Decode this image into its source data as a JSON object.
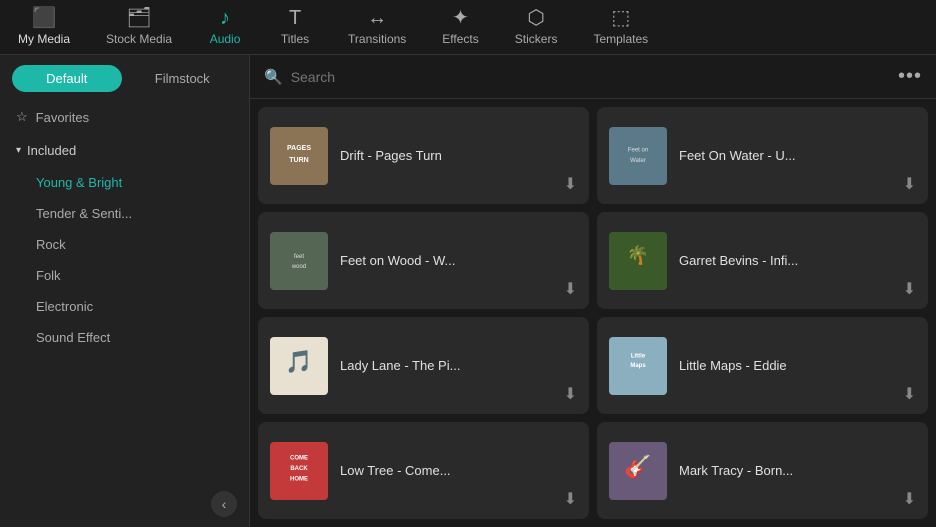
{
  "nav": {
    "items": [
      {
        "id": "my-media",
        "label": "My Media",
        "icon": "🖥",
        "active": true
      },
      {
        "id": "stock-media",
        "label": "Stock Media",
        "icon": "🗂",
        "active": false
      },
      {
        "id": "audio",
        "label": "Audio",
        "icon": "♪",
        "active": true
      },
      {
        "id": "titles",
        "label": "Titles",
        "icon": "T",
        "active": false
      },
      {
        "id": "transitions",
        "label": "Transitions",
        "icon": "↔",
        "active": false
      },
      {
        "id": "effects",
        "label": "Effects",
        "icon": "✦",
        "active": false
      },
      {
        "id": "stickers",
        "label": "Stickers",
        "icon": "⬡",
        "active": false
      },
      {
        "id": "templates",
        "label": "Templates",
        "icon": "⬚",
        "active": false
      }
    ]
  },
  "sidebar": {
    "tabs": [
      {
        "id": "default",
        "label": "Default",
        "active": true
      },
      {
        "id": "filmstock",
        "label": "Filmstock",
        "active": false
      }
    ],
    "favorites_label": "Favorites",
    "included_label": "Included",
    "sub_items": [
      {
        "id": "young-bright",
        "label": "Young & Bright",
        "active": true
      },
      {
        "id": "tender-senti",
        "label": "Tender & Senti...",
        "active": false
      },
      {
        "id": "rock",
        "label": "Rock",
        "active": false
      },
      {
        "id": "folk",
        "label": "Folk",
        "active": false
      },
      {
        "id": "electronic",
        "label": "Electronic",
        "active": false
      },
      {
        "id": "sound-effect",
        "label": "Sound Effect",
        "active": false
      }
    ],
    "collapse_label": "‹"
  },
  "search": {
    "placeholder": "Search"
  },
  "music_cards": [
    {
      "id": "card-1",
      "title": "Drift - Pages Turn",
      "art_color": "#8B7355",
      "art_label": "PAGES\nTURN"
    },
    {
      "id": "card-2",
      "title": "Feet On Water - U...",
      "art_color": "#5a7a8a",
      "art_label": "Feet on\nWater"
    },
    {
      "id": "card-3",
      "title": "Feet on Wood - W...",
      "art_color": "#6a7a5a",
      "art_label": "feet\nwood"
    },
    {
      "id": "card-4",
      "title": "Garret Bevins - Infi...",
      "art_color": "#4a6a3a",
      "art_label": "palm\nleaf"
    },
    {
      "id": "card-5",
      "title": "Lady Lane - The Pi...",
      "art_color": "#cccccc",
      "art_label": "🎵"
    },
    {
      "id": "card-6",
      "title": "Little Maps - Eddie",
      "art_color": "#8ab0b8",
      "art_label": "Little\nMaps"
    },
    {
      "id": "card-7",
      "title": "Low Tree - Come...",
      "art_color": "#c44a4a",
      "art_label": "COME\nBACK\nHOME"
    },
    {
      "id": "card-8",
      "title": "Mark Tracy - Born...",
      "art_color": "#7a6a8a",
      "art_label": "🎸"
    }
  ]
}
